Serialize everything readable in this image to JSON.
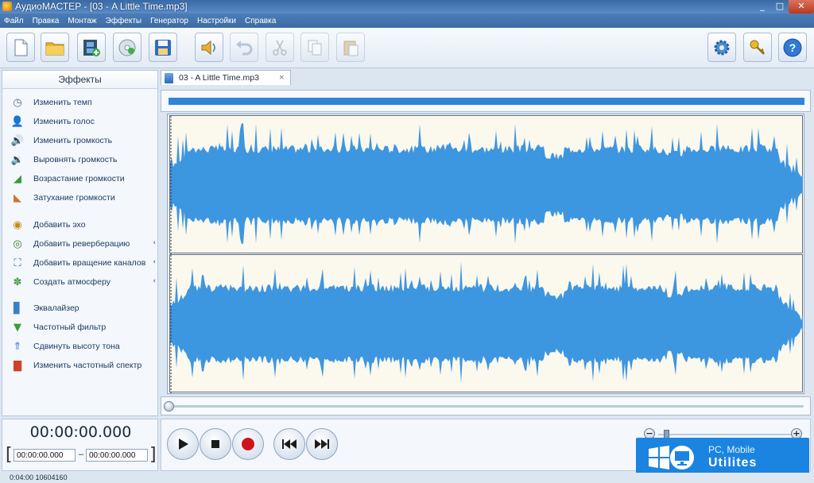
{
  "window": {
    "title": "АудиоМАСТЕР - [03 - A Little Time.mp3]",
    "controls": [
      "minimize",
      "maximize",
      "close"
    ]
  },
  "menu": [
    "Файл",
    "Правка",
    "Монтаж",
    "Эффекты",
    "Генератор",
    "Настройки",
    "Справка"
  ],
  "toolbar": {
    "buttons": [
      {
        "name": "new-file",
        "icon": "new-document-icon",
        "enabled": true
      },
      {
        "name": "open-file",
        "icon": "folder-icon",
        "enabled": true
      },
      {
        "name": "add-from-video",
        "icon": "film-add-icon",
        "enabled": true
      },
      {
        "name": "load-from-cd",
        "icon": "cd-icon",
        "enabled": true
      },
      {
        "name": "save",
        "icon": "floppy-icon",
        "enabled": true
      },
      {
        "name": "play-speaker",
        "icon": "speaker-icon",
        "enabled": true
      },
      {
        "name": "undo",
        "icon": "undo-icon",
        "enabled": false
      },
      {
        "name": "cut",
        "icon": "scissors-icon",
        "enabled": false
      },
      {
        "name": "copy",
        "icon": "copy-icon",
        "enabled": false
      },
      {
        "name": "paste",
        "icon": "paste-icon",
        "enabled": false
      },
      {
        "name": "settings",
        "icon": "gear-icon",
        "enabled": true
      },
      {
        "name": "activation",
        "icon": "key-icon",
        "enabled": true
      },
      {
        "name": "help",
        "icon": "help-icon",
        "enabled": true
      }
    ]
  },
  "effects_panel": {
    "header": "Эффекты",
    "items": [
      {
        "label": "Изменить темп",
        "icon": "clock-icon",
        "submenu": false
      },
      {
        "label": "Изменить голос",
        "icon": "person-icon",
        "submenu": false
      },
      {
        "label": "Изменить громкость",
        "icon": "volume-icon",
        "submenu": false
      },
      {
        "label": "Выровнять громкость",
        "icon": "level-volume-icon",
        "submenu": false
      },
      {
        "label": "Возрастание громкости",
        "icon": "fade-in-icon",
        "submenu": false
      },
      {
        "label": "Затухание громкости",
        "icon": "fade-out-icon",
        "submenu": false
      },
      {
        "label": "Добавить эхо",
        "icon": "echo-icon",
        "submenu": false
      },
      {
        "label": "Добавить реверберацию",
        "icon": "reverb-icon",
        "submenu": true
      },
      {
        "label": "Добавить вращение каналов",
        "icon": "rotate-channels-icon",
        "submenu": true
      },
      {
        "label": "Создать атмосферу",
        "icon": "atmosphere-icon",
        "submenu": true
      },
      {
        "label": "Эквалайзер",
        "icon": "equalizer-icon",
        "submenu": false
      },
      {
        "label": "Частотный фильтр",
        "icon": "filter-icon",
        "submenu": false
      },
      {
        "label": "Сдвинуть высоту тона",
        "icon": "pitch-icon",
        "submenu": false
      },
      {
        "label": "Изменить частотный спектр",
        "icon": "spectrum-icon",
        "submenu": false
      }
    ]
  },
  "tab": {
    "label": "03 - A Little Time.mp3",
    "close": "×"
  },
  "time": {
    "current": "00:00:00.000",
    "start": "00:00:00.000",
    "end": "00:00:00.000",
    "separator": "–"
  },
  "transport": {
    "buttons": [
      "play",
      "stop",
      "record",
      "rewind",
      "fast-forward"
    ],
    "zoom_out": "−",
    "zoom_in": "+"
  },
  "watermark": {
    "line1": "PC, Mobile",
    "line2": "Utilites"
  },
  "status": "0:04:00 10604160",
  "colors": {
    "waveform": "#3d96e0",
    "waveform_bg": "#fbf8ee",
    "overview": "#2f86d8"
  }
}
